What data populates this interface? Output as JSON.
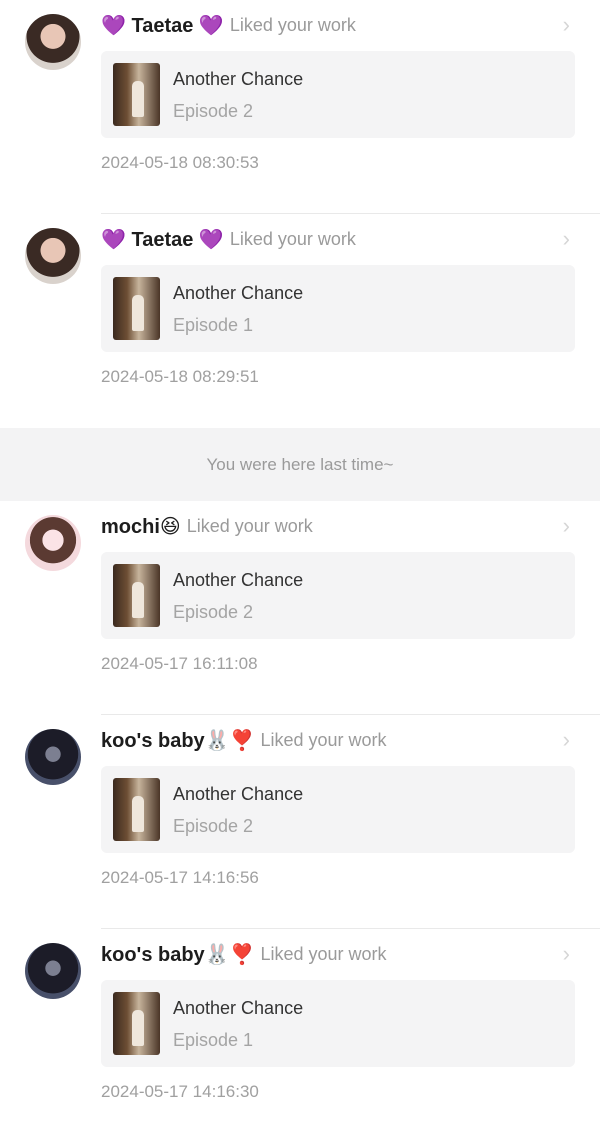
{
  "colors": {
    "accent_purple": "#8a3ffc"
  },
  "last_time_text": "You were here last time~",
  "items": [
    {
      "avatar_icon": "avatar-taetae",
      "name": "💜 Taetae 💜",
      "action": "Liked your work",
      "card_title": "Another Chance",
      "card_subtitle": "Episode 2",
      "timestamp": "2024-05-18 08:30:53"
    },
    {
      "avatar_icon": "avatar-taetae",
      "name": "💜 Taetae 💜",
      "action": "Liked your work",
      "card_title": "Another Chance",
      "card_subtitle": "Episode 1",
      "timestamp": "2024-05-18 08:29:51"
    },
    {
      "avatar_icon": "avatar-mochi",
      "name": "mochi😆",
      "action": "Liked your work",
      "card_title": "Another Chance",
      "card_subtitle": "Episode 2",
      "timestamp": "2024-05-17 16:11:08"
    },
    {
      "avatar_icon": "avatar-koos-baby",
      "name": "koo's baby🐰❣️",
      "action": "Liked your work",
      "card_title": "Another Chance",
      "card_subtitle": "Episode 2",
      "timestamp": "2024-05-17 14:16:56"
    },
    {
      "avatar_icon": "avatar-koos-baby",
      "name": "koo's baby🐰❣️",
      "action": "Liked your work",
      "card_title": "Another Chance",
      "card_subtitle": "Episode 1",
      "timestamp": "2024-05-17 14:16:30"
    }
  ]
}
